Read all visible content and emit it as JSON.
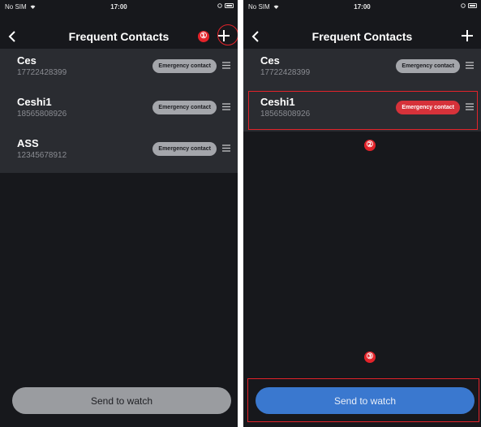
{
  "screens": [
    {
      "status": {
        "carrier": "No SIM",
        "time": "17:00"
      },
      "nav": {
        "title": "Frequent Contacts"
      },
      "contacts": [
        {
          "name": "Ces",
          "phone": "17722428399",
          "badge": "Emergency contact",
          "active": false
        },
        {
          "name": "Ceshi1",
          "phone": "18565808926",
          "badge": "Emergency contact",
          "active": false
        },
        {
          "name": "ASS",
          "phone": "12345678912",
          "badge": "Emergency contact",
          "active": false
        }
      ],
      "send_button": "Send to watch",
      "callouts": [
        "①"
      ]
    },
    {
      "status": {
        "carrier": "No SIM",
        "time": "17:00"
      },
      "nav": {
        "title": "Frequent Contacts"
      },
      "contacts": [
        {
          "name": "Ces",
          "phone": "17722428399",
          "badge": "Emergency contact",
          "active": false
        },
        {
          "name": "Ceshi1",
          "phone": "18565808926",
          "badge": "Emergency contact",
          "active": true
        }
      ],
      "send_button": "Send to watch",
      "callouts": [
        "②",
        "③"
      ]
    }
  ],
  "colors": {
    "background": "#17181c",
    "list_background": "#2a2c31",
    "badge_inactive": "#a4a6ab",
    "badge_active": "#d6323a",
    "send_button_inactive": "#9a9ca0",
    "send_button_active": "#3a78cf",
    "annotation": "#e3232a"
  },
  "icons": {
    "back": "chevron-left-icon",
    "add": "plus-icon",
    "drag": "drag-handle-icon",
    "wifi": "wifi-icon",
    "battery": "battery-icon"
  }
}
